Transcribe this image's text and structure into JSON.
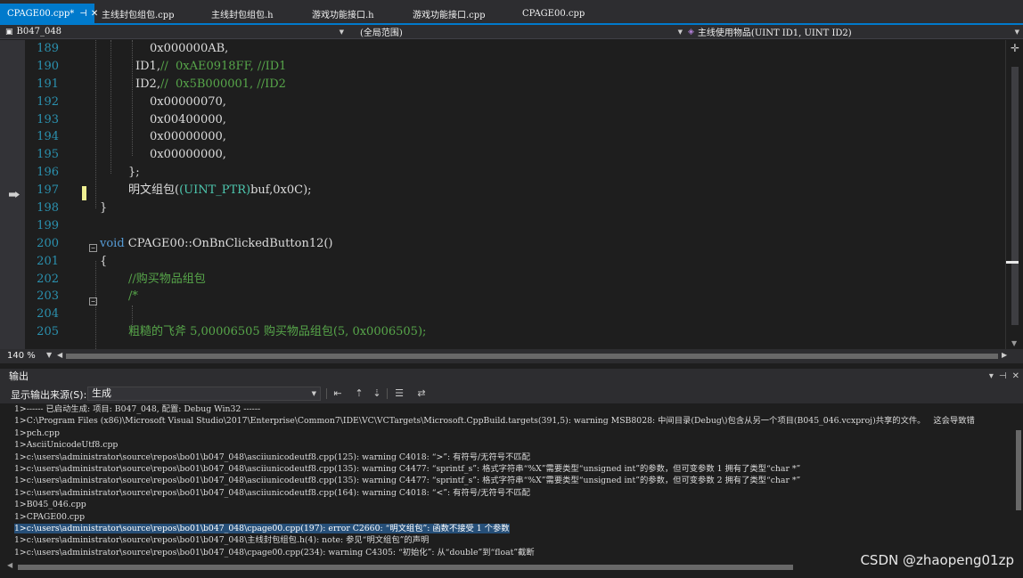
{
  "tabs": [
    {
      "label": "CPAGE00.cpp*",
      "active": true
    },
    {
      "label": "主线封包组包.cpp",
      "active": false
    },
    {
      "label": "主线封包组包.h",
      "active": false
    },
    {
      "label": "游戏功能接口.h",
      "active": false
    },
    {
      "label": "游戏功能接口.cpp",
      "active": false
    },
    {
      "label": "CPAGE00.cpp",
      "active": false
    }
  ],
  "tab_controls": {
    "pin": "⊣",
    "close": "✕"
  },
  "navbar": {
    "project": "B047_048",
    "scope": "(全局范围)",
    "member": "主线使用物品(UINT ID1, UINT ID2)"
  },
  "editor": {
    "line_numbers": [
      "189",
      "190",
      "191",
      "192",
      "193",
      "194",
      "195",
      "196",
      "197",
      "198",
      "199",
      "200",
      "201",
      "202",
      "203",
      "204",
      "205"
    ],
    "lines": {
      "l189": "0x000000AB,",
      "l190_code": "ID1,",
      "l190_comment": "//  0xAE0918FF, //ID1",
      "l191_code": "ID2,",
      "l191_comment": "//  0x5B000001, //ID2",
      "l192": "0x00000070,",
      "l193": "0x00400000,",
      "l194": "0x00000000,",
      "l195": "0x00000000,",
      "l196": "};",
      "l197_func": "明文组包(",
      "l197_type": "(UINT_PTR)",
      "l197_rest": "buf,0x0C);",
      "l198": "}",
      "l199": "",
      "l200_kw": "void",
      "l200_rest": " CPAGE00::OnBnClickedButton12()",
      "l201": "{",
      "l202": "//购买物品组包",
      "l203": "/*",
      "l204": "",
      "l205": "粗糙的飞斧 5,00006505 购买物品组包(5, 0x0006505);"
    }
  },
  "status": {
    "zoom": "140 %"
  },
  "output": {
    "title": "输出",
    "source_label": "显示输出来源(S):",
    "source_value": "生成",
    "lines": [
      "1>------ 已启动生成: 项目: B047_048, 配置: Debug Win32 ------",
      "1>C:\\Program Files (x86)\\Microsoft Visual Studio\\2017\\Enterprise\\Common7\\IDE\\VC\\VCTargets\\Microsoft.CppBuild.targets(391,5): warning MSB8028: 中间目录(Debug\\)包含从另一个项目(B045_046.vcxproj)共享的文件。   这会导致错",
      "1>pch.cpp",
      "1>AsciiUnicodeUtf8.cpp",
      "1>c:\\users\\administrator\\source\\repos\\bo01\\b047_048\\asciiunicodeutf8.cpp(125): warning C4018: “>”: 有符号/无符号不匹配",
      "1>c:\\users\\administrator\\source\\repos\\bo01\\b047_048\\asciiunicodeutf8.cpp(135): warning C4477: “sprintf_s”: 格式字符串“%X”需要类型“unsigned int”的参数，但可变参数 1 拥有了类型“char *”",
      "1>c:\\users\\administrator\\source\\repos\\bo01\\b047_048\\asciiunicodeutf8.cpp(135): warning C4477: “sprintf_s”: 格式字符串“%X”需要类型“unsigned int”的参数，但可变参数 2 拥有了类型“char *”",
      "1>c:\\users\\administrator\\source\\repos\\bo01\\b047_048\\asciiunicodeutf8.cpp(164): warning C4018: “<”: 有符号/无符号不匹配",
      "1>B045_046.cpp",
      "1>CPAGE00.cpp",
      "1>c:\\users\\administrator\\source\\repos\\bo01\\b047_048\\cpage00.cpp(197): error C2660: “明文组包”: 函数不接受 1 个参数",
      "1>c:\\users\\administrator\\source\\repos\\bo01\\b047_048\\主线封包组包.h(4): note: 参见“明文组包”的声明",
      "1>c:\\users\\administrator\\source\\repos\\bo01\\b047_048\\cpage00.cpp(234): warning C4305: “初始化”: 从“double”到“float”截断"
    ],
    "selected_index": 10
  },
  "watermark": "CSDN @zhaopeng01zp",
  "colors": {
    "accent": "#007acc",
    "keyword": "#569cd6",
    "comment": "#57a64a",
    "type": "#4ec9b0",
    "linenumber": "#2b91af",
    "selection": "#264f78"
  }
}
